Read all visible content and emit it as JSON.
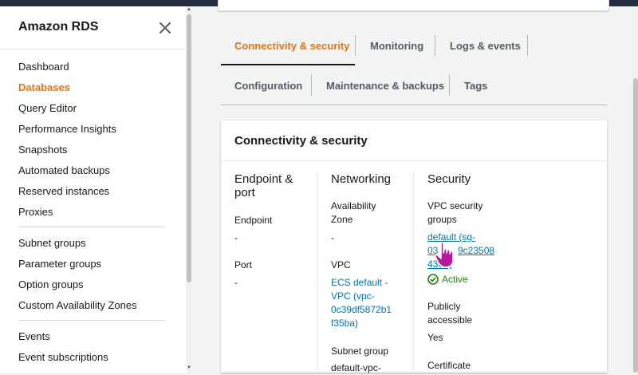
{
  "sidebar": {
    "title": "Amazon RDS",
    "close_icon": "close-icon",
    "items": [
      {
        "label": "Dashboard"
      },
      {
        "label": "Databases",
        "active": true
      },
      {
        "label": "Query Editor"
      },
      {
        "label": "Performance Insights"
      },
      {
        "label": "Snapshots"
      },
      {
        "label": "Automated backups"
      },
      {
        "label": "Reserved instances"
      },
      {
        "label": "Proxies"
      },
      {
        "label": "Subnet groups"
      },
      {
        "label": "Parameter groups"
      },
      {
        "label": "Option groups"
      },
      {
        "label": "Custom Availability Zones"
      },
      {
        "label": "Events"
      },
      {
        "label": "Event subscriptions"
      }
    ]
  },
  "tabs": [
    {
      "label": "Connectivity & security",
      "active": true
    },
    {
      "label": "Monitoring"
    },
    {
      "label": "Logs & events"
    },
    {
      "label": "Configuration"
    },
    {
      "label": "Maintenance & backups"
    },
    {
      "label": "Tags"
    }
  ],
  "panel": {
    "title": "Connectivity & security",
    "endpoint_port": {
      "heading_line1": "Endpoint &",
      "heading_line2": "port",
      "endpoint_label": "Endpoint",
      "endpoint_value": "-",
      "port_label": "Port",
      "port_value": "-"
    },
    "networking": {
      "heading": "Networking",
      "az_label_line1": "Availability",
      "az_label_line2": "Zone",
      "az_value": "-",
      "vpc_label": "VPC",
      "vpc_value_lines": [
        "ECS default -",
        "VPC (vpc-",
        "0c39df5872b1",
        "f35ba)"
      ],
      "subnet_label": "Subnet group",
      "subnet_value": "default-vpc-"
    },
    "security": {
      "heading": "Security",
      "sg_label_line1": "VPC security",
      "sg_label_line2": "groups",
      "sg_link_lines": [
        "default (sg-",
        "03",
        "9c23508",
        "436e)"
      ],
      "sg_status": "Active",
      "public_label_line1": "Publicly",
      "public_label_line2": "accessible",
      "public_value": "Yes",
      "cert_label": "Certificate"
    }
  },
  "colors": {
    "accent": "#ec7211",
    "link": "#0073bb",
    "success": "#1d8102"
  }
}
